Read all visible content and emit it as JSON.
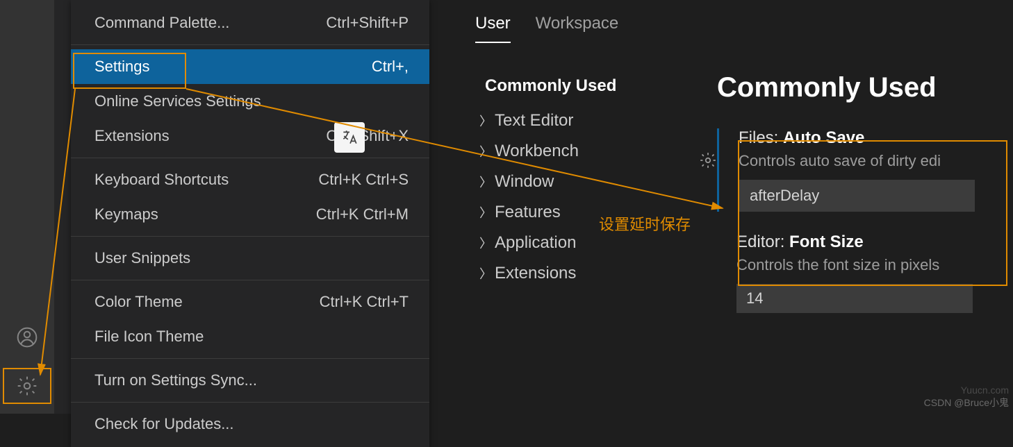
{
  "menu": {
    "command_palette": {
      "label": "Command Palette...",
      "shortcut": "Ctrl+Shift+P"
    },
    "settings": {
      "label": "Settings",
      "shortcut": "Ctrl+,"
    },
    "online_services": {
      "label": "Online Services Settings"
    },
    "extensions": {
      "label": "Extensions",
      "shortcut": "Ctrl+Shift+X"
    },
    "keyboard_shortcuts": {
      "label": "Keyboard Shortcuts",
      "shortcut": "Ctrl+K Ctrl+S"
    },
    "keymaps": {
      "label": "Keymaps",
      "shortcut": "Ctrl+K Ctrl+M"
    },
    "user_snippets": {
      "label": "User Snippets"
    },
    "color_theme": {
      "label": "Color Theme",
      "shortcut": "Ctrl+K Ctrl+T"
    },
    "file_icon_theme": {
      "label": "File Icon Theme"
    },
    "settings_sync": {
      "label": "Turn on Settings Sync..."
    },
    "check_updates": {
      "label": "Check for Updates..."
    }
  },
  "tabs": {
    "user": "User",
    "workspace": "Workspace"
  },
  "tree": {
    "header": "Commonly Used",
    "items": [
      "Text Editor",
      "Workbench",
      "Window",
      "Features",
      "Application",
      "Extensions"
    ]
  },
  "page_title": "Commonly Used",
  "autosave": {
    "title_prefix": "Files: ",
    "title_bold": "Auto Save",
    "desc": "Controls auto save of dirty edi",
    "value": "afterDelay"
  },
  "fontsize": {
    "title_prefix": "Editor: ",
    "title_bold": "Font Size",
    "desc": "Controls the font size in pixels",
    "value": "14"
  },
  "annotation": "设置延时保存",
  "watermark1": "Yuucn.com",
  "watermark2": "CSDN @Bruce小鬼"
}
